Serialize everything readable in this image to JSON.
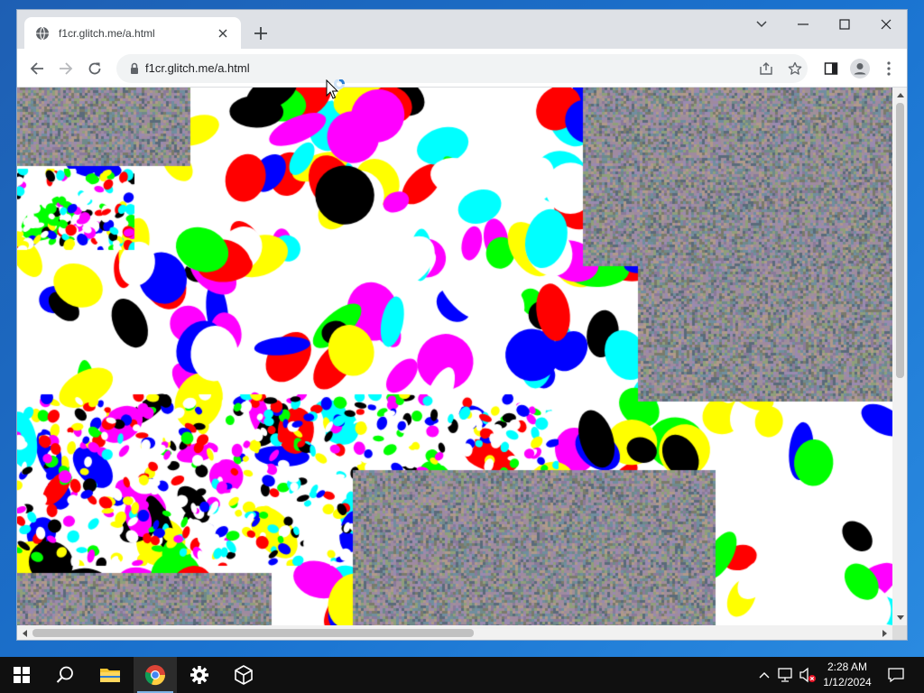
{
  "browser": {
    "tab": {
      "title": "f1cr.glitch.me/a.html"
    },
    "omnibox": {
      "url": "f1cr.glitch.me/a.html"
    }
  },
  "page": {
    "colors": [
      "#ffffff",
      "#ffffff",
      "#ffffff",
      "#00ffff",
      "#ffff00",
      "#ff00ff",
      "#0000ff",
      "#00ff00",
      "#ff0000",
      "#000000"
    ],
    "noise_colors": [
      "#8a7a9a",
      "#6f8a8a",
      "#a0909a",
      "#7a7a6a",
      "#9a8ab0",
      "#708ea0",
      "#b09a8a",
      "#5a6a7a",
      "#8fa07a",
      "#a08aa0"
    ]
  },
  "taskbar": {
    "items": [
      "start",
      "search",
      "file-explorer",
      "chrome",
      "settings",
      "3d-viewer"
    ],
    "clock": {
      "time": "2:28 AM",
      "date": "1/12/2024"
    }
  }
}
